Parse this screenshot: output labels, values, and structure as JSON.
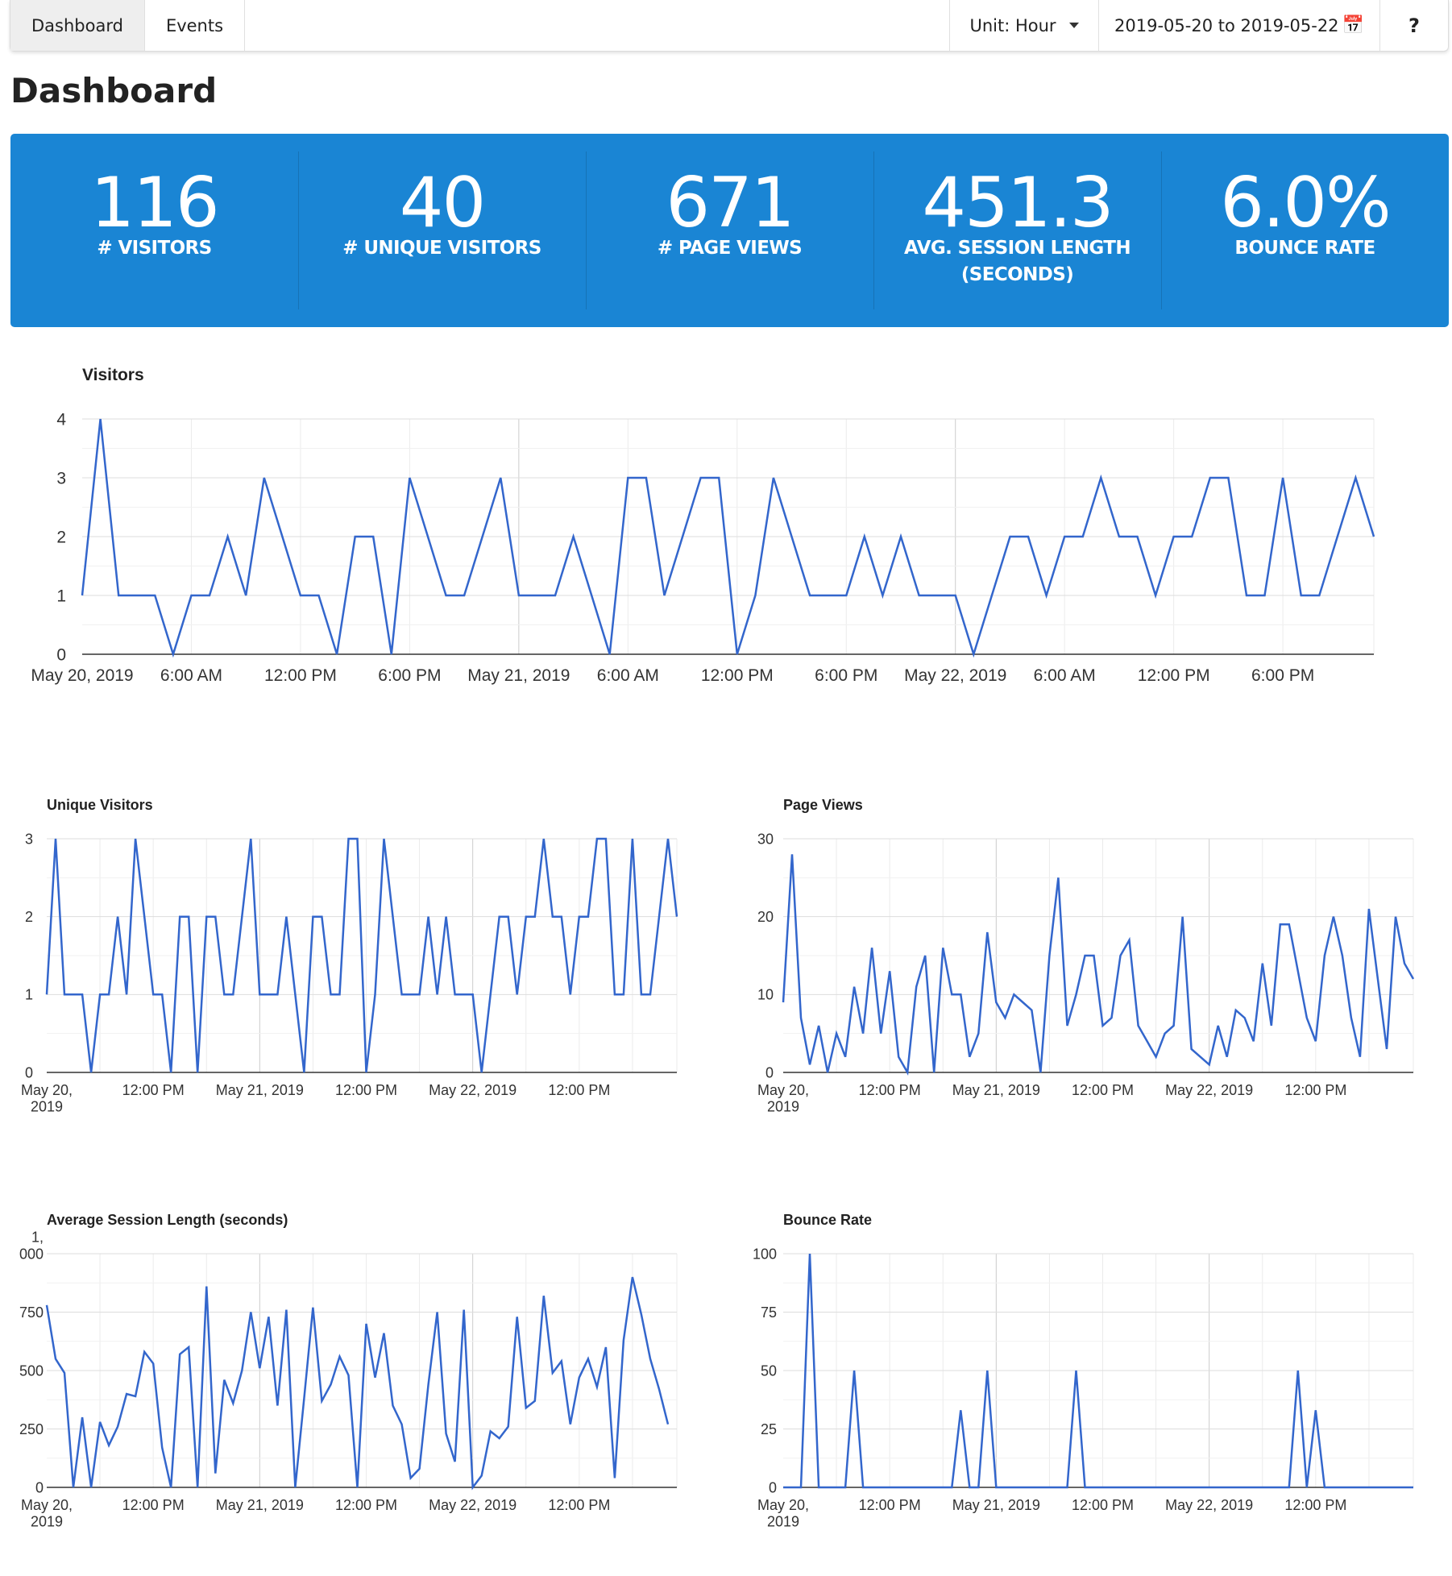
{
  "nav": {
    "tabs": [
      {
        "label": "Dashboard"
      },
      {
        "label": "Events"
      }
    ]
  },
  "toolbar": {
    "unit_label": "Unit: Hour",
    "date_range": "2019-05-20 to 2019-05-22",
    "calendar_icon": "calendar-icon",
    "help_label": "?"
  },
  "page": {
    "title": "Dashboard"
  },
  "stats": [
    {
      "value": "116",
      "label": "# VISITORS"
    },
    {
      "value": "40",
      "label": "# UNIQUE VISITORS"
    },
    {
      "value": "671",
      "label": "# PAGE VIEWS"
    },
    {
      "value": "451.3",
      "label": "AVG. SESSION LENGTH (SECONDS)"
    },
    {
      "value": "6.0%",
      "label": "BOUNCE RATE"
    }
  ],
  "colors": {
    "accent": "#1a85d4",
    "line": "#3366cc"
  },
  "chart_data": [
    {
      "id": "visitors",
      "type": "line",
      "title": "Visitors",
      "x_unit": "hour",
      "x_start": "2019-05-20 00:00",
      "ylim": [
        0,
        4
      ],
      "yticks": [
        "0",
        "1",
        "2",
        "3",
        "4"
      ],
      "xtick_labels": [
        "May 20, 2019",
        "6:00 AM",
        "12:00 PM",
        "6:00 PM",
        "May 21, 2019",
        "6:00 AM",
        "12:00 PM",
        "6:00 PM",
        "May 22, 2019",
        "6:00 AM",
        "12:00 PM",
        "6:00 PM"
      ],
      "values": [
        1,
        4,
        1,
        1,
        1,
        0,
        1,
        1,
        2,
        1,
        3,
        2,
        1,
        1,
        0,
        2,
        2,
        0,
        3,
        2,
        1,
        1,
        2,
        3,
        1,
        1,
        1,
        2,
        1,
        0,
        3,
        3,
        1,
        2,
        3,
        3,
        0,
        1,
        3,
        2,
        1,
        1,
        1,
        2,
        1,
        2,
        1,
        1,
        1,
        0,
        1,
        2,
        2,
        1,
        2,
        2,
        3,
        2,
        2,
        1,
        2,
        2,
        3,
        3,
        1,
        1,
        3,
        1,
        1,
        2,
        3,
        2
      ]
    },
    {
      "id": "unique-visitors",
      "type": "line",
      "title": "Unique Visitors",
      "x_unit": "hour",
      "x_start": "2019-05-20 00:00",
      "ylim": [
        0,
        3
      ],
      "yticks": [
        "0",
        "1",
        "2",
        "3"
      ],
      "xtick_labels": [
        "May 20,\n2019",
        "12:00 PM",
        "May 21, 2019",
        "12:00 PM",
        "May 22, 2019",
        "12:00 PM"
      ],
      "values": [
        1,
        3,
        1,
        1,
        1,
        0,
        1,
        1,
        2,
        1,
        3,
        2,
        1,
        1,
        0,
        2,
        2,
        0,
        2,
        2,
        1,
        1,
        2,
        3,
        1,
        1,
        1,
        2,
        1,
        0,
        2,
        2,
        1,
        1,
        3,
        3,
        0,
        1,
        3,
        2,
        1,
        1,
        1,
        2,
        1,
        2,
        1,
        1,
        1,
        0,
        1,
        2,
        2,
        1,
        2,
        2,
        3,
        2,
        2,
        1,
        2,
        2,
        3,
        3,
        1,
        1,
        3,
        1,
        1,
        2,
        3,
        2
      ]
    },
    {
      "id": "page-views",
      "type": "line",
      "title": "Page Views",
      "x_unit": "hour",
      "x_start": "2019-05-20 00:00",
      "ylim": [
        0,
        30
      ],
      "yticks": [
        "0",
        "10",
        "20",
        "30"
      ],
      "xtick_labels": [
        "May 20,\n2019",
        "12:00 PM",
        "May 21, 2019",
        "12:00 PM",
        "May 22, 2019",
        "12:00 PM"
      ],
      "values": [
        9,
        28,
        7,
        1,
        6,
        0,
        5,
        2,
        11,
        5,
        16,
        5,
        13,
        2,
        0,
        11,
        15,
        0,
        16,
        10,
        10,
        2,
        5,
        18,
        9,
        7,
        10,
        9,
        8,
        0,
        15,
        25,
        6,
        10,
        15,
        15,
        6,
        7,
        15,
        17,
        6,
        4,
        2,
        5,
        6,
        20,
        3,
        2,
        1,
        6,
        2,
        8,
        7,
        4,
        14,
        6,
        19,
        19,
        13,
        7,
        4,
        15,
        20,
        15,
        7,
        2,
        21,
        12,
        3,
        20,
        14,
        12
      ]
    },
    {
      "id": "avg-session-length",
      "type": "line",
      "title": "Average Session Length (seconds)",
      "x_unit": "hour",
      "x_start": "2019-05-20 00:00",
      "ylim": [
        0,
        1000
      ],
      "yticks": [
        "0",
        "250",
        "500",
        "750",
        "1,\n000"
      ],
      "xtick_labels": [
        "May 20,\n2019",
        "12:00 PM",
        "May 21, 2019",
        "12:00 PM",
        "May 22, 2019",
        "12:00 PM"
      ],
      "values": [
        780,
        550,
        490,
        0,
        300,
        0,
        280,
        180,
        260,
        400,
        390,
        580,
        530,
        170,
        0,
        570,
        600,
        0,
        860,
        60,
        460,
        360,
        500,
        750,
        510,
        730,
        350,
        760,
        0,
        380,
        770,
        370,
        440,
        560,
        480,
        0,
        700,
        470,
        660,
        350,
        270,
        40,
        80,
        440,
        750,
        230,
        110,
        760,
        0,
        50,
        240,
        210,
        260,
        730,
        340,
        370,
        820,
        490,
        540,
        270,
        470,
        550,
        430,
        600,
        40,
        630,
        900,
        740,
        550,
        420,
        270
      ]
    },
    {
      "id": "bounce-rate",
      "type": "line",
      "title": "Bounce Rate",
      "x_unit": "hour",
      "x_start": "2019-05-20 00:00",
      "ylim": [
        0,
        100
      ],
      "yticks": [
        "0",
        "25",
        "50",
        "75",
        "100"
      ],
      "xtick_labels": [
        "May 20,\n2019",
        "12:00 PM",
        "May 21, 2019",
        "12:00 PM",
        "May 22, 2019",
        "12:00 PM"
      ],
      "values": [
        0,
        0,
        0,
        100,
        0,
        0,
        0,
        0,
        50,
        0,
        0,
        0,
        0,
        0,
        0,
        0,
        0,
        0,
        0,
        0,
        33,
        0,
        0,
        50,
        0,
        0,
        0,
        0,
        0,
        0,
        0,
        0,
        0,
        50,
        0,
        0,
        0,
        0,
        0,
        0,
        0,
        0,
        0,
        0,
        0,
        0,
        0,
        0,
        0,
        0,
        0,
        0,
        0,
        0,
        0,
        0,
        0,
        0,
        50,
        0,
        33,
        0,
        0,
        0,
        0,
        0,
        0,
        0,
        0,
        0,
        0,
        0
      ]
    }
  ]
}
